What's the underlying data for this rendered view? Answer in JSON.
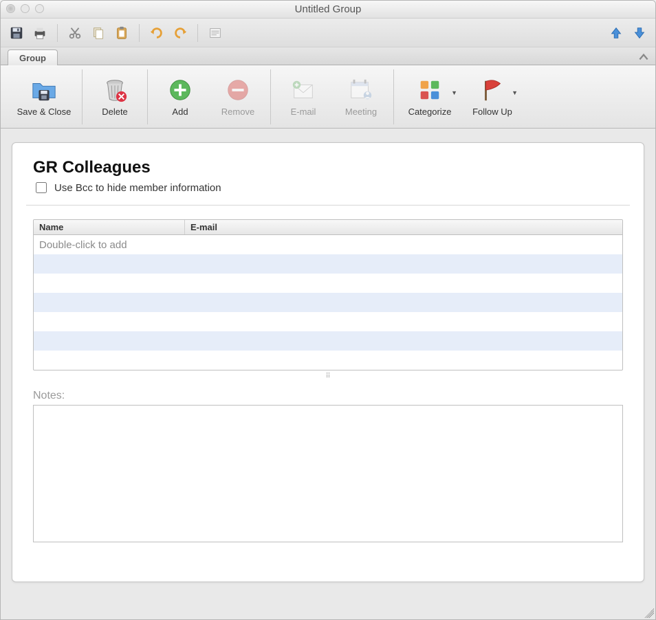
{
  "window": {
    "title": "Untitled Group"
  },
  "quickbar": {
    "save_tip": "Save",
    "print_tip": "Print",
    "cut_tip": "Cut",
    "copy_tip": "Copy",
    "paste_tip": "Paste",
    "undo_tip": "Undo",
    "redo_tip": "Redo",
    "recurrence_tip": "Options",
    "prev_tip": "Previous",
    "next_tip": "Next"
  },
  "tabs": {
    "group": "Group"
  },
  "ribbon": {
    "save_close": "Save & Close",
    "delete": "Delete",
    "add": "Add",
    "remove": "Remove",
    "email": "E-mail",
    "meeting": "Meeting",
    "categorize": "Categorize",
    "followup": "Follow Up"
  },
  "content": {
    "group_name": "GR Colleagues",
    "bcc_label": "Use Bcc to hide member information",
    "bcc_checked": false,
    "columns": {
      "name": "Name",
      "email": "E-mail"
    },
    "placeholder_row": "Double-click to add",
    "notes_label": "Notes:",
    "notes_value": ""
  }
}
